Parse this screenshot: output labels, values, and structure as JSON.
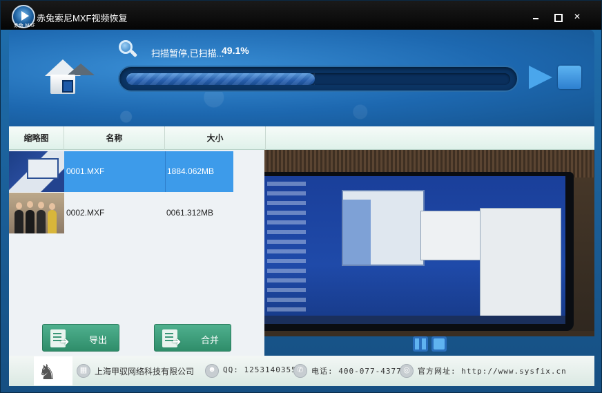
{
  "window": {
    "title": "赤兔索尼MXF视频恢复",
    "logo_caption": "赤兔 MXF",
    "controls": {
      "minimize": "",
      "maximize": "",
      "close": "✕"
    }
  },
  "header": {
    "status_text": "扫描暂停,已扫描...",
    "progress_percent": 49.1,
    "progress_label": "49.1%"
  },
  "table": {
    "columns": [
      "缩略图",
      "名称",
      "大小"
    ],
    "rows": [
      {
        "name": "0001.MXF",
        "size": "1884.062MB",
        "selected": true
      },
      {
        "name": "0002.MXF",
        "size": "0061.312MB",
        "selected": false
      }
    ]
  },
  "actions": {
    "export_label": "导出",
    "merge_label": "合并"
  },
  "footer": {
    "company": "上海甲驭网络科技有限公司",
    "qq": "QQ: 1253140355",
    "phone": "电话: 400-077-4377",
    "website": "官方网址: http://www.sysfix.cn"
  },
  "colors": {
    "accent": "#3d9bea",
    "header_blue": "#1d68b0",
    "button_green": "#3a9a78"
  }
}
